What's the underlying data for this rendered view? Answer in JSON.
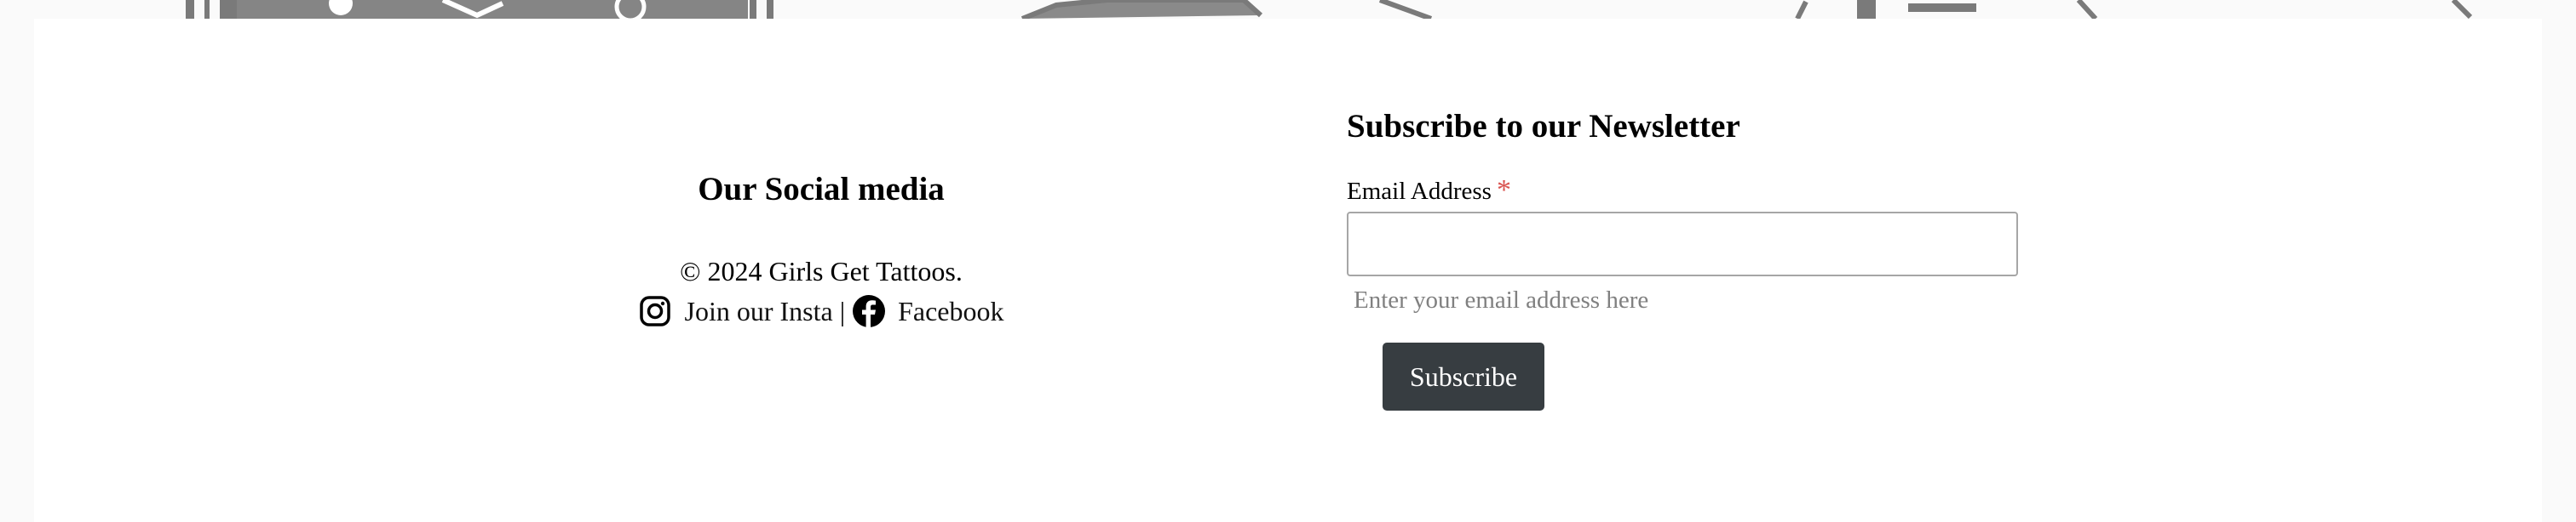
{
  "social": {
    "heading": "Our Social media",
    "copyright": "© 2024 Girls Get Tattoos.",
    "instagram_label": "Join our Insta",
    "separator": "|",
    "facebook_label": "Facebook"
  },
  "newsletter": {
    "heading": "Subscribe to our Newsletter",
    "email_label": "Email Address",
    "required_mark": "*",
    "email_value": "",
    "email_help": "Enter your email address here",
    "subscribe_label": "Subscribe"
  },
  "icons": {
    "instagram": "instagram-icon",
    "facebook": "facebook-icon"
  },
  "colors": {
    "button_bg": "#373d41",
    "required": "#d9534f",
    "help_text": "#808080",
    "background_art": "#7a7a7a"
  }
}
